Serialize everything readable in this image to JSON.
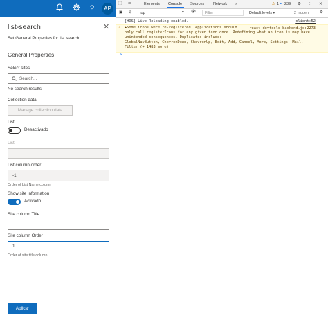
{
  "topbar": {
    "bell_icon": "bell-icon",
    "settings_icon": "gear-icon",
    "help_label": "?",
    "avatar": "AP"
  },
  "pane": {
    "title": "list-search",
    "description": "Set General Properties for list search",
    "section_title": "General Properties",
    "select_sites": {
      "label": "Select sites",
      "placeholder": "Search...",
      "empty_text": "No search results"
    },
    "collection_data": {
      "label": "Collection data",
      "button": "Manage collection data"
    },
    "list_toggle": {
      "label": "List",
      "state_text": "Desactivado"
    },
    "list_field": {
      "label": "List",
      "value": ""
    },
    "list_column_order": {
      "label": "List column order",
      "value": "-1",
      "hint": "Order of List Name column"
    },
    "show_site_toggle": {
      "label": "Show site information",
      "state_text": "Activado"
    },
    "site_column_title": {
      "label": "Site column Title",
      "value": ""
    },
    "site_column_order": {
      "label": "Site column Order",
      "value": "1",
      "hint": "Order of site title column"
    },
    "apply": "Aplicar"
  },
  "devtools": {
    "tabs": [
      "Elements",
      "Console",
      "Sources",
      "Network",
      "»"
    ],
    "active_tab": "Console",
    "warnings_count": "1",
    "messages_count": "239",
    "toolbar": {
      "context": "top",
      "filter_placeholder": "Filter",
      "levels": "Default levels ▾",
      "hidden": "2 hidden"
    },
    "console": {
      "log1": "[HDS] Live Reloading enabled.",
      "log1_src": "client:52",
      "warning_lines": [
        "▶Some icons were re-registered. Applications should",
        "only call registerIcons for any given icon once. Redefining what an icon is may have",
        "unintended consequences. Duplicates include:",
        "GlobalNavButton, ChevronDown, ChevronUp, Edit, Add, Cancel, More, Settings, Mail,",
        "Filter (+ 1483 more)"
      ],
      "warning_src": "react-devtools-backend.js:2273",
      "prompt": ">"
    }
  },
  "colors": {
    "brand": "#0f6cbd",
    "warning_bg": "#fffbe5"
  }
}
